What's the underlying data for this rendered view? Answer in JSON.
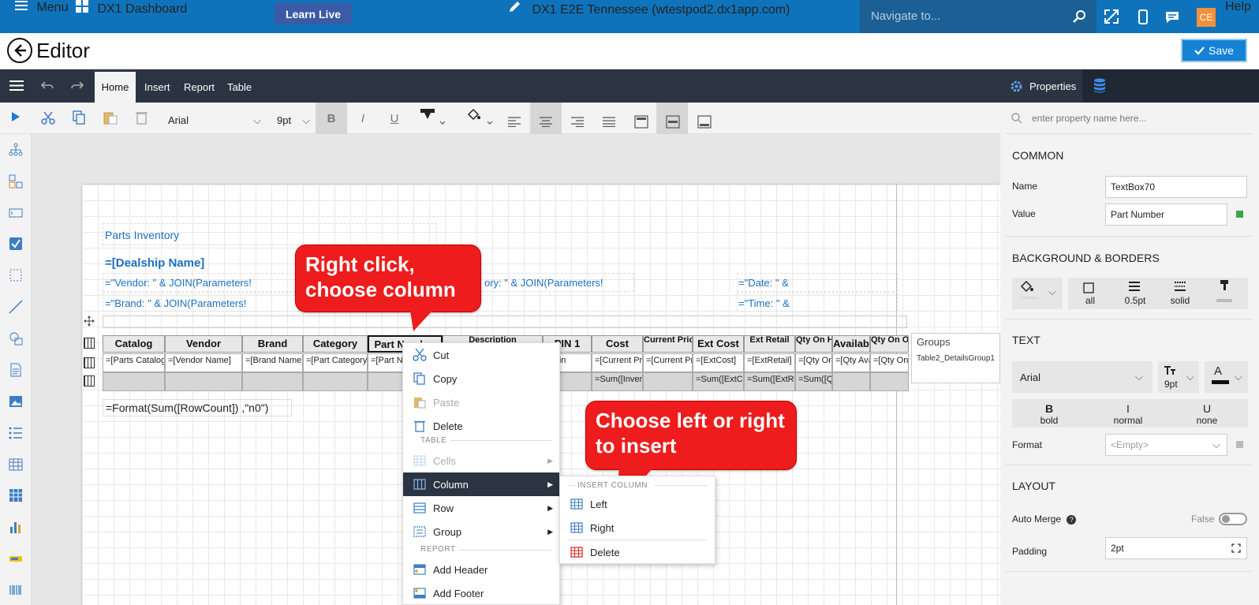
{
  "topbar": {
    "menu": "Menu",
    "dashboard": "DX1 Dashboard",
    "learn_live": "Learn Live",
    "title": "DX1 E2E Tennessee (wtestpod2.dx1app.com)",
    "navigate_placeholder": "Navigate to...",
    "avatar": "CE",
    "help": "Help"
  },
  "editor": {
    "title": "Editor",
    "save": "Save"
  },
  "ribbon": {
    "tabs": [
      "Home",
      "Insert",
      "Report",
      "Table"
    ],
    "properties_tab": "Properties"
  },
  "toolbar": {
    "font": "Arial",
    "size": "9pt",
    "bold": "B",
    "italic": "I",
    "underline": "U"
  },
  "report": {
    "title": "Parts Inventory",
    "dealship": "=[Dealship Name]",
    "vendor_expr": "=\"Vendor: \" & JOIN(Parameters!",
    "category_expr": "ory: \" & JOIN(Parameters!",
    "date_expr": "=\"Date: \" &",
    "brand_expr": "=\"Brand: \" & JOIN(Parameters!",
    "time_expr": "=\"Time: \" &",
    "format_expr": "=Format(Sum([RowCount]) ,\"n0\")",
    "table": {
      "headers": [
        "Catalog",
        "Vendor",
        "Brand",
        "Category",
        "Part Number",
        "Description",
        "PIN 1",
        "Cost",
        "Current Price",
        "Ext Cost",
        "Ext Retail",
        "Qty On Hand",
        "Availab",
        "Qty On Order"
      ],
      "details": [
        "=[Parts Catalog Name]",
        "=[Vendor Name]",
        "=[Brand Name]",
        "=[Part Category Name]",
        "=[Part Nu",
        "",
        "=[Pin",
        "=[Current Price]",
        "=[Current Price]",
        "=[ExtCost]",
        "=[ExtRetail]",
        "=[Qty OnHand]",
        "=[Qty Available]",
        "=[Qty OnOrder]"
      ],
      "footer": [
        "",
        "",
        "",
        "",
        "",
        "",
        "",
        "=Sum([InventoryCost])",
        "",
        "=Sum([ExtCost])",
        "=Sum([ExtRetail])",
        "=Sum([QtyOnHand])",
        "",
        ""
      ]
    },
    "groups_label": "Groups",
    "groups_item": "Table2_DetailsGroup1"
  },
  "callouts": {
    "one": "Right click, choose column",
    "two": "Choose left or right to insert"
  },
  "context_menu": {
    "cut": "Cut",
    "copy": "Copy",
    "paste": "Paste",
    "delete": "Delete",
    "table_section": "TABLE",
    "cells": "Cells",
    "column": "Column",
    "row": "Row",
    "group": "Group",
    "report_section": "REPORT",
    "add_header": "Add Header",
    "add_footer": "Add Footer"
  },
  "submenu": {
    "section": "INSERT COLUMN",
    "left": "Left",
    "right": "Right",
    "delete": "Delete"
  },
  "properties": {
    "search_placeholder": "enter property name here...",
    "common": "COMMON",
    "name_label": "Name",
    "name_value": "TextBox70",
    "value_label": "Value",
    "value_value": "Part Number",
    "bg_section": "BACKGROUND & BORDERS",
    "border_all": "all",
    "border_width": "0.5pt",
    "border_style": "solid",
    "text_section": "TEXT",
    "font": "Arial",
    "font_size": "9pt",
    "color_letter": "A",
    "bold_glyph": "B",
    "bold_label": "bold",
    "italic_glyph": "I",
    "italic_label": "normal",
    "underline_glyph": "U",
    "underline_label": "none",
    "format_label": "Format",
    "format_value": "<Empty>",
    "layout_section": "LAYOUT",
    "auto_merge_label": "Auto Merge",
    "auto_merge_value": "False",
    "padding_label": "Padding",
    "padding_value": "2pt"
  },
  "colors": {
    "topbar": "#0f73bb",
    "ribbon": "#2b3442",
    "callout": "#ee1c1c",
    "link": "#1d6fbd"
  }
}
